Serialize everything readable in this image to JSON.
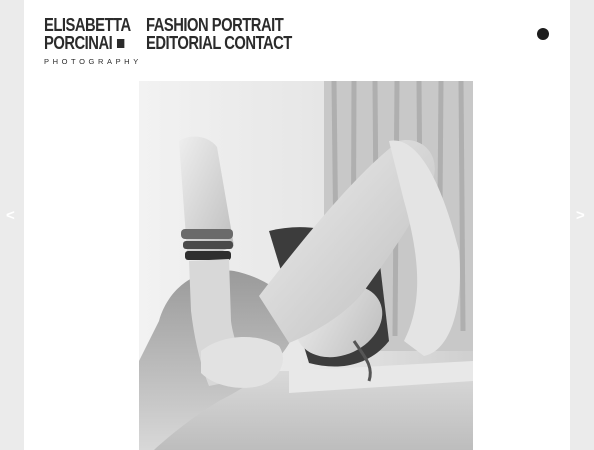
{
  "brand": {
    "name_line1": "ELISABETTA",
    "name_line2": "PORCINAI",
    "subtitle": "PHOTOGRAPHY"
  },
  "nav": {
    "items": [
      "FASHION",
      "PORTRAIT",
      "EDITORIAL",
      "CONTACT"
    ]
  },
  "slideshow": {
    "prev_label": "<",
    "next_label": ">"
  },
  "colors": {
    "background": "#ebebeb",
    "page": "#ffffff",
    "text": "#2b2b2b"
  }
}
